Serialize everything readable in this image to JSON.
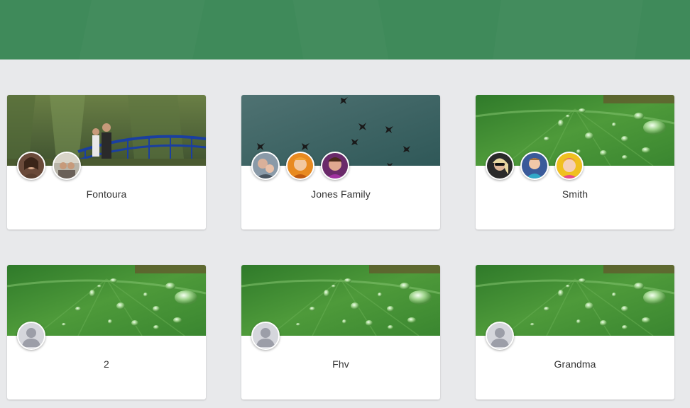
{
  "groups": [
    {
      "name": "Fontoura",
      "cover": "park-bridge-photo",
      "members": [
        {
          "icon": "woman-portrait-avatar"
        },
        {
          "icon": "family-portrait-avatar"
        }
      ]
    },
    {
      "name": "Jones Family",
      "cover": "birds-sky-photo",
      "members": [
        {
          "icon": "mother-child-avatar"
        },
        {
          "icon": "baby-orange-avatar"
        },
        {
          "icon": "child-purple-avatar"
        }
      ]
    },
    {
      "name": "Smith",
      "cover": "leaf-water-drops-photo",
      "members": [
        {
          "icon": "woman-sunglasses-avatar"
        },
        {
          "icon": "baby-blue-avatar"
        },
        {
          "icon": "baby-pink-avatar"
        }
      ]
    },
    {
      "name": "2",
      "cover": "leaf-water-drops-photo",
      "members": [
        {
          "icon": "default-user-icon"
        }
      ]
    },
    {
      "name": "Fhv",
      "cover": "leaf-water-drops-photo",
      "members": [
        {
          "icon": "default-user-icon"
        }
      ]
    },
    {
      "name": "Grandma",
      "cover": "leaf-water-drops-photo",
      "members": [
        {
          "icon": "default-user-icon"
        }
      ]
    }
  ],
  "colors": {
    "header": "#3f8a5a",
    "background": "#e8e9eb",
    "card": "#ffffff",
    "title_text": "#333333"
  }
}
